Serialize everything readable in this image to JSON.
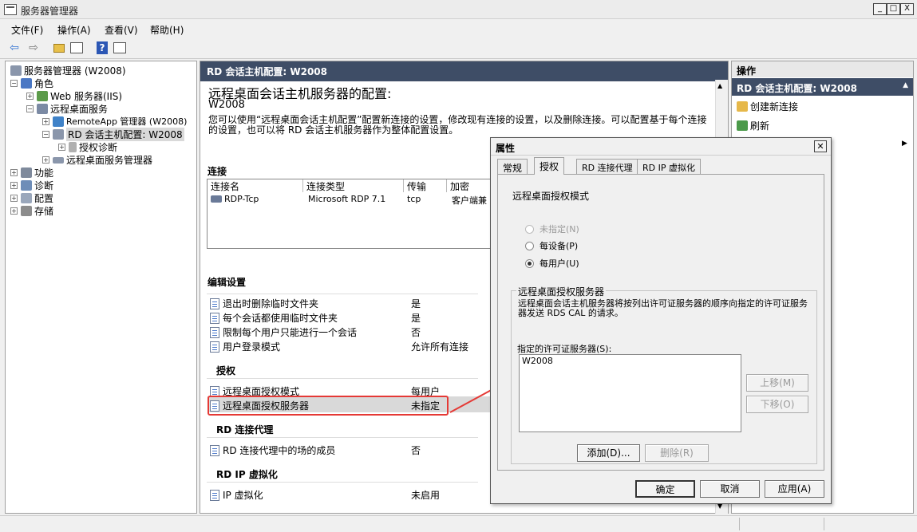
{
  "window": {
    "title": "服务器管理器",
    "btn_min": "_",
    "btn_max": "□",
    "btn_close": "X"
  },
  "menu": {
    "file": "文件(F)",
    "action": "操作(A)",
    "view": "查看(V)",
    "help": "帮助(H)"
  },
  "toolbar": {
    "back": "⇦",
    "forward": "⇨",
    "help": "?"
  },
  "tree": {
    "root": "服务器管理器 (W2008)",
    "roles": "角色",
    "web": "Web 服务器(IIS)",
    "rds": "远程桌面服务",
    "remoteapp": "RemoteApp 管理器 (W2008)",
    "rdconfig": "RD 会话主机配置: W2008",
    "licdiag": "授权诊断",
    "rdsmanager": "远程桌面服务管理器",
    "features": "功能",
    "diagnostics": "诊断",
    "config": "配置",
    "storage": "存储"
  },
  "center": {
    "header": "RD 会话主机配置: W2008",
    "title": "远程桌面会话主机服务器的配置:",
    "server": "W2008",
    "desc": "您可以使用“远程桌面会话主机配置”配置新连接的设置，修改现有连接的设置，以及删除连接。可以配置基于每个连接的设置，也可以将 RD 会话主机服务器作为整体配置设置。",
    "connections_label": "连接",
    "columns": [
      "连接名",
      "连接类型",
      "传输",
      "加密"
    ],
    "row": {
      "name": "RDP-Tcp",
      "type": "Microsoft RDP 7.1",
      "transport": "tcp",
      "encryption": "客户端兼"
    },
    "edit_settings": "编辑设置",
    "general": [
      {
        "label": "退出时删除临时文件夹",
        "value": "是"
      },
      {
        "label": "每个会话都使用临时文件夹",
        "value": "是"
      },
      {
        "label": "限制每个用户只能进行一个会话",
        "value": "否"
      },
      {
        "label": "用户登录模式",
        "value": "允许所有连接"
      }
    ],
    "licensing": "授权",
    "lic_items": [
      {
        "label": "远程桌面授权模式",
        "value": "每用户"
      },
      {
        "label": "远程桌面授权服务器",
        "value": "未指定"
      }
    ],
    "broker": "RD 连接代理",
    "broker_item": {
      "label": "RD 连接代理中的场的成员",
      "value": "否"
    },
    "ipv": "RD IP 虚拟化",
    "ipv_item": {
      "label": "IP 虚拟化",
      "value": "未启用"
    }
  },
  "actions": {
    "header": "操作",
    "sub": "RD 会话主机配置: W2008",
    "new_conn": "创建新连接",
    "refresh": "刷新"
  },
  "dialog": {
    "title": "属性",
    "tabs": [
      "常规",
      "授权",
      "RD 连接代理",
      "RD IP 虚拟化"
    ],
    "mode_label": "远程桌面授权模式",
    "radios": [
      "未指定(N)",
      "每设备(P)",
      "每用户(U)"
    ],
    "selected": 2,
    "group_title": "远程桌面授权服务器",
    "group_desc": "远程桌面会话主机服务器将按列出许可证服务器的顺序向指定的许可证服务器发送 RDS CAL 的请求。",
    "list_label": "指定的许可证服务器(S):",
    "list_items": [
      "W2008"
    ],
    "move_up": "上移(M)",
    "move_down": "下移(O)",
    "add": "添加(D)...",
    "remove": "删除(R)",
    "ok": "确定",
    "cancel": "取消",
    "apply": "应用(A)"
  },
  "colors": {
    "header_bg": "#3e4d66",
    "highlight": "#e53935",
    "selected_bg": "#d9d9d9"
  }
}
